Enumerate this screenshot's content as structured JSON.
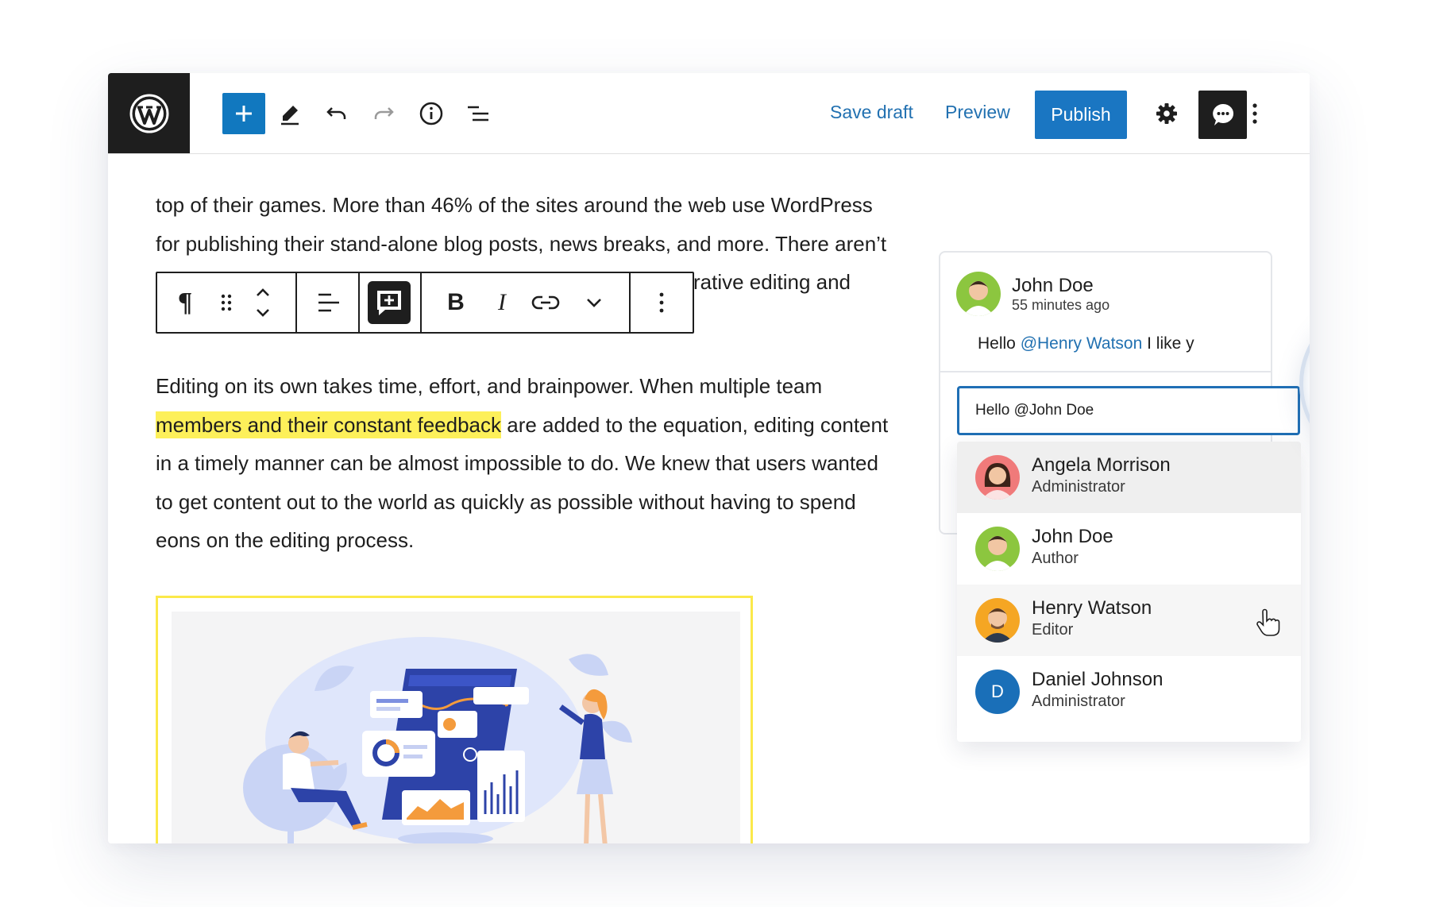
{
  "toolbar": {
    "save_draft": "Save draft",
    "preview": "Preview",
    "publish": "Publish"
  },
  "content": {
    "para1_line1": "top of their games. More than 46% of the sites around the web use WordPress",
    "para1_line2": "for publishing their stand-alone blog posts, news breaks, and more. There aren’t",
    "para1_line3": "rative editing and",
    "para2_line1": "Editing on its own takes time, effort, and brainpower. When multiple team",
    "para2_highlight": "members and their constant feedback",
    "para2_line2_rest": " are added to the equation, editing content",
    "para2_line3": "in a timely manner can be almost impossible to do. We knew that users wanted",
    "para2_line4": "to get content out to the world as quickly as possible without having to spend",
    "para2_line5": "eons on the editing process."
  },
  "block_toolbar": {
    "paragraph_glyph": "¶",
    "bold_glyph": "B",
    "italic_glyph": "I"
  },
  "comment": {
    "author": "John Doe",
    "time": "55 minutes ago",
    "text_prefix": "Hello ",
    "mention": "@Henry Watson",
    "text_suffix": " I like y",
    "reply_value": "Hello @John Doe"
  },
  "mention_list": [
    {
      "name": "Angela Morrison",
      "role": "Administrator"
    },
    {
      "name": "John Doe",
      "role": "Author"
    },
    {
      "name": "Henry Watson",
      "role": "Editor"
    },
    {
      "name": "Daniel Johnson",
      "role": "Administrator",
      "initial": "D"
    }
  ],
  "colors": {
    "accent": "#1a76c2",
    "highlight": "#fdf05a",
    "link": "#2271b1",
    "dark": "#1e1e1e"
  }
}
